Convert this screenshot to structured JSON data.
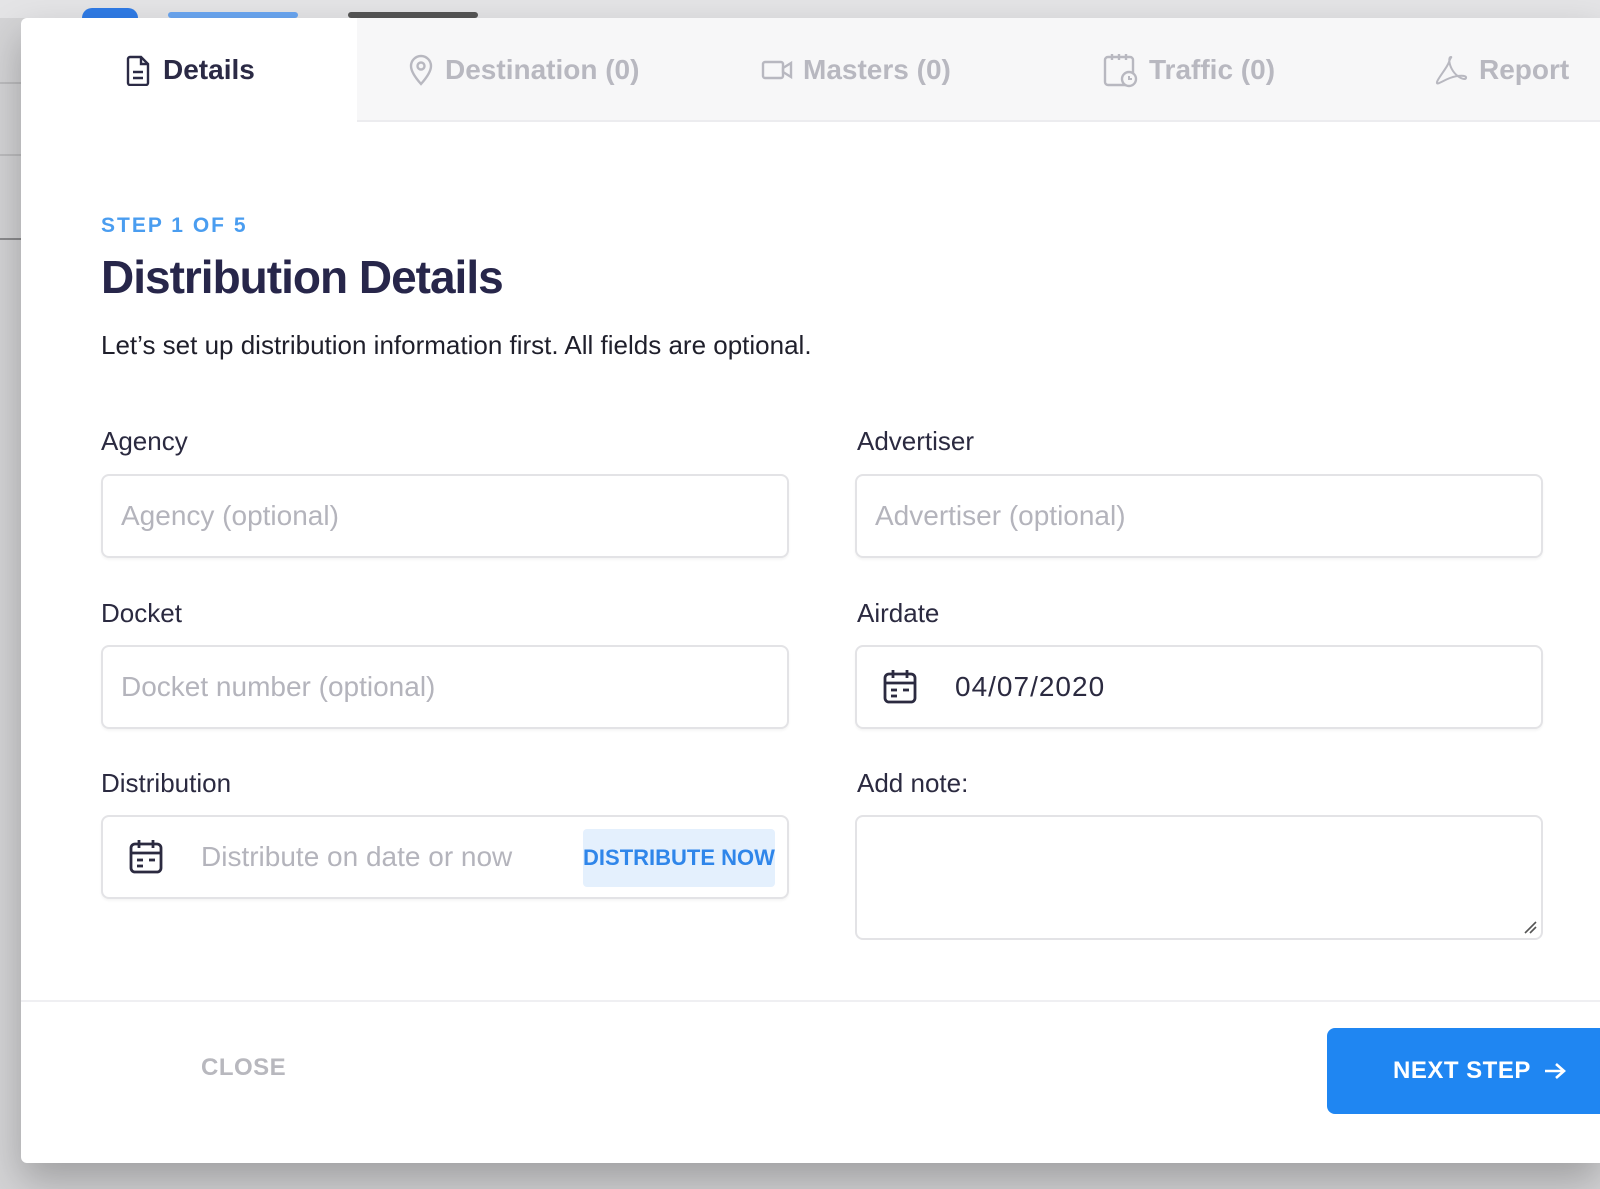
{
  "tabs": [
    {
      "label": "Details",
      "icon": "document-icon",
      "active": true
    },
    {
      "label": "Destination (0)",
      "icon": "location-pin-icon",
      "active": false
    },
    {
      "label": "Masters (0)",
      "icon": "video-camera-icon",
      "active": false
    },
    {
      "label": "Traffic (0)",
      "icon": "calendar-clock-icon",
      "active": false
    },
    {
      "label": "Report",
      "icon": "pdf-icon",
      "active": false
    }
  ],
  "step_label": "STEP 1 OF 5",
  "title": "Distribution Details",
  "subtitle": "Let’s set up distribution information first. All fields are optional.",
  "form": {
    "agency": {
      "label": "Agency",
      "placeholder": "Agency (optional)",
      "value": ""
    },
    "advertiser": {
      "label": "Advertiser",
      "placeholder": "Advertiser (optional)",
      "value": ""
    },
    "docket": {
      "label": "Docket",
      "placeholder": "Docket number (optional)",
      "value": ""
    },
    "airdate": {
      "label": "Airdate",
      "value": "04/07/2020"
    },
    "distribution": {
      "label": "Distribution",
      "placeholder": "Distribute on date or now",
      "button_label": "DISTRIBUTE NOW"
    },
    "note": {
      "label": "Add note:",
      "value": ""
    }
  },
  "footer": {
    "close_label": "CLOSE",
    "next_label": "NEXT STEP"
  },
  "colors": {
    "accent": "#1f86f2",
    "step_text": "#4a9df0",
    "title_text": "#27264a"
  }
}
